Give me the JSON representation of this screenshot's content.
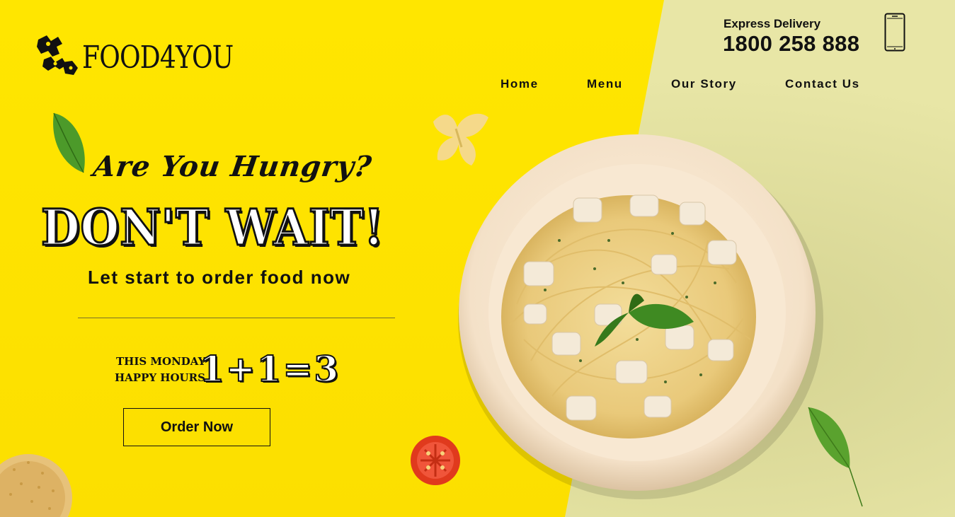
{
  "brand": {
    "name": "FOOD4YOU"
  },
  "header": {
    "delivery_label": "Express Delivery",
    "delivery_phone": "1800 258 888",
    "phone_icon": "smartphone-icon"
  },
  "nav": {
    "items": [
      {
        "label": "Home"
      },
      {
        "label": "Menu"
      },
      {
        "label": "Our Story"
      },
      {
        "label": "Contact Us"
      }
    ]
  },
  "hero": {
    "headline_script": "Are You Hungry?",
    "headline_main": "DON'T WAIT!",
    "tagline": "Let start to order food now",
    "promo_line1": "THIS MONDAY",
    "promo_line2": "HAPPY HOURS",
    "promo_offer": "1+1=3",
    "cta_label": "Order Now"
  },
  "colors": {
    "primary_yellow": "#fde200",
    "secondary_pale": "#e8e6a6",
    "text": "#111111"
  },
  "images": {
    "dish": "spaghetti-chicken-plate",
    "decor": [
      "basil-leaf",
      "farfalle-pasta",
      "tomato-slice",
      "dry-spaghetti-bundle"
    ]
  }
}
